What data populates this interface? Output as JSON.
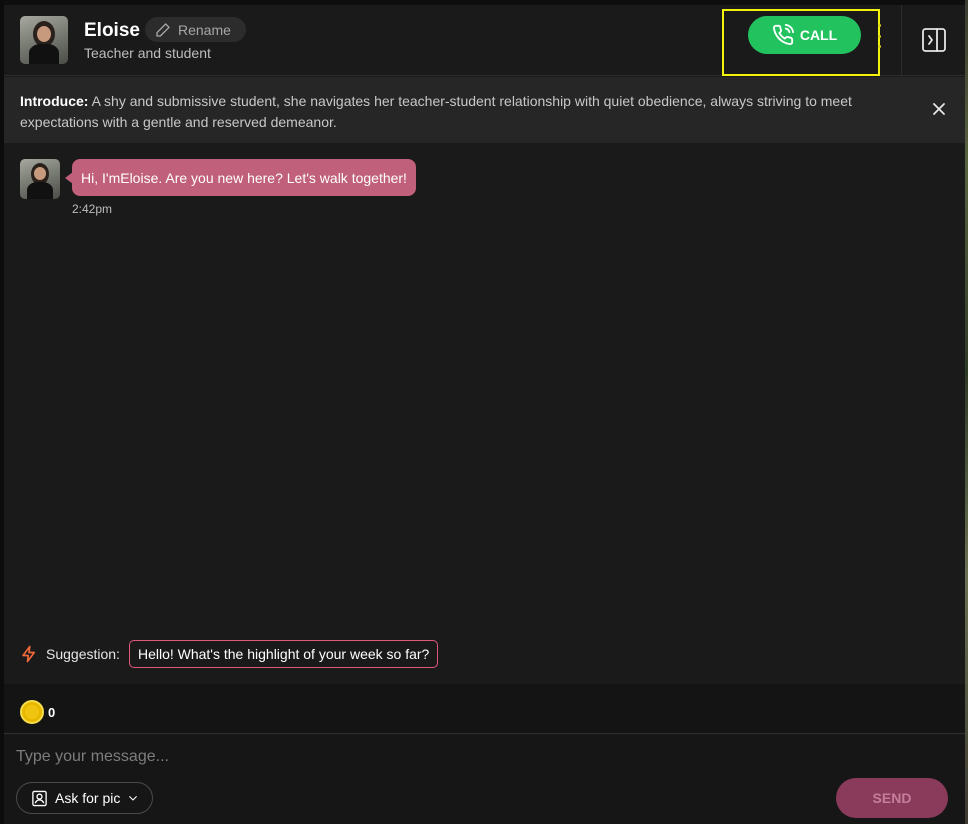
{
  "header": {
    "name": "Eloise",
    "rename_label": "Rename",
    "subtitle": "Teacher and student",
    "call_label": "CALL"
  },
  "intro": {
    "label": "Introduce:",
    "text": "A shy and submissive student, she navigates her teacher-student relationship with quiet obedience, always striving to meet expectations with a gentle and reserved demeanor."
  },
  "messages": [
    {
      "sender": "Eloise",
      "text": "Hi, I'mEloise. Are you new here? Let's walk together!",
      "time": "2:42pm"
    }
  ],
  "suggestion": {
    "label": "Suggestion:",
    "text": "Hello! What's the highlight of your week so far?"
  },
  "coins": {
    "count": "0"
  },
  "composer": {
    "placeholder": "Type your message...",
    "ask_pic_label": "Ask for pic",
    "send_label": "SEND"
  },
  "colors": {
    "call_green": "#22c35e",
    "bubble_pink": "#c0607a",
    "send_disabled": "#8a3a5a",
    "highlight_yellow": "#f2f20c"
  },
  "icons": [
    "pencil-icon",
    "phone-icon",
    "more-vertical-icon",
    "panel-collapse-icon",
    "close-icon",
    "lightning-icon",
    "coin-icon",
    "portrait-icon",
    "chevron-down-icon"
  ]
}
